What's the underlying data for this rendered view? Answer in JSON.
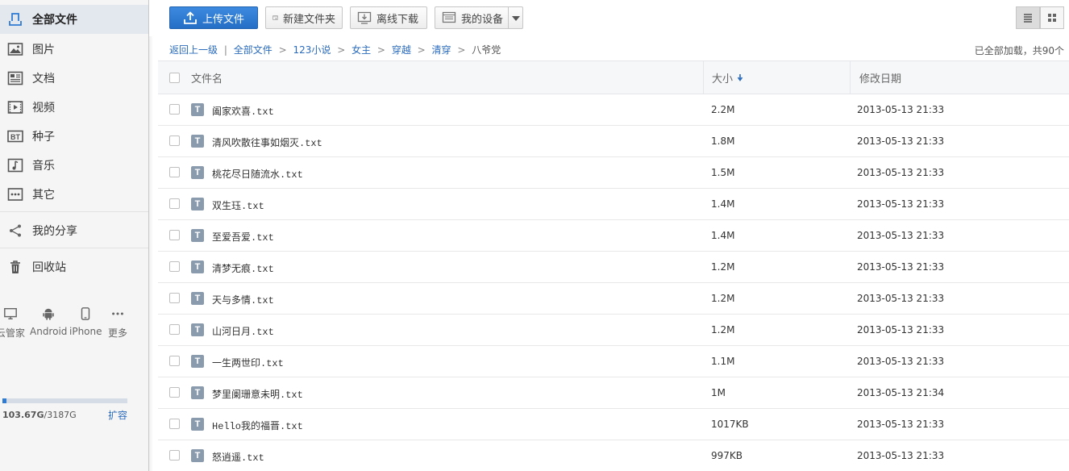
{
  "sidebar": {
    "nav": [
      {
        "label": "全部文件",
        "icon": "all-files-icon"
      },
      {
        "label": "图片",
        "icon": "image-icon"
      },
      {
        "label": "文档",
        "icon": "document-icon"
      },
      {
        "label": "视频",
        "icon": "video-icon"
      },
      {
        "label": "种子",
        "icon": "bt-icon"
      },
      {
        "label": "音乐",
        "icon": "music-icon"
      },
      {
        "label": "其它",
        "icon": "other-icon"
      }
    ],
    "share": {
      "label": "我的分享",
      "icon": "share-icon"
    },
    "recycle": {
      "label": "回收站",
      "icon": "trash-icon"
    },
    "devices": [
      {
        "label": "云管家",
        "icon": "desktop-icon"
      },
      {
        "label": "Android",
        "icon": "android-icon"
      },
      {
        "label": "iPhone",
        "icon": "iphone-icon"
      },
      {
        "label": "更多",
        "icon": "more-icon"
      }
    ],
    "quota": {
      "used": "103.67G",
      "total": "/3187G",
      "used_fraction": 0.033,
      "expand_label": "扩容"
    }
  },
  "toolbar": {
    "upload_label": "上传文件",
    "new_folder_label": "新建文件夹",
    "offline_label": "离线下载",
    "devices_label": "我的设备"
  },
  "breadcrumb": {
    "back_label": "返回上一级",
    "separator": "|",
    "path": [
      "全部文件",
      "123小说",
      "女主",
      "穿越",
      "清穿"
    ],
    "current": "八爷党",
    "arrow": ">"
  },
  "status": "已全部加载，共90个",
  "table": {
    "headers": {
      "name": "文件名",
      "size": "大小",
      "date": "修改日期"
    },
    "rows": [
      {
        "name": "阖家欢喜.txt",
        "size": "2.2M",
        "date": "2013-05-13 21:33"
      },
      {
        "name": "清风吹散往事如烟灭.txt",
        "size": "1.8M",
        "date": "2013-05-13 21:33"
      },
      {
        "name": "桃花尽日随流水.txt",
        "size": "1.5M",
        "date": "2013-05-13 21:33"
      },
      {
        "name": "双生珏.txt",
        "size": "1.4M",
        "date": "2013-05-13 21:33"
      },
      {
        "name": "至爱吾爱.txt",
        "size": "1.4M",
        "date": "2013-05-13 21:33"
      },
      {
        "name": "清梦无痕.txt",
        "size": "1.2M",
        "date": "2013-05-13 21:33"
      },
      {
        "name": "天与多情.txt",
        "size": "1.2M",
        "date": "2013-05-13 21:33"
      },
      {
        "name": "山河日月.txt",
        "size": "1.2M",
        "date": "2013-05-13 21:33"
      },
      {
        "name": "一生两世印.txt",
        "size": "1.1M",
        "date": "2013-05-13 21:33"
      },
      {
        "name": "梦里阑珊意未明.txt",
        "size": "1M",
        "date": "2013-05-13 21:34"
      },
      {
        "name": "Hello我的福晋.txt",
        "size": "1017KB",
        "date": "2013-05-13 21:33"
      },
      {
        "name": "怒逍遥.txt",
        "size": "997KB",
        "date": "2013-05-13 21:33"
      }
    ]
  },
  "file_icon_glyph": "T",
  "colors": {
    "accent": "#2f7bd2",
    "link": "#2a6bbd"
  }
}
